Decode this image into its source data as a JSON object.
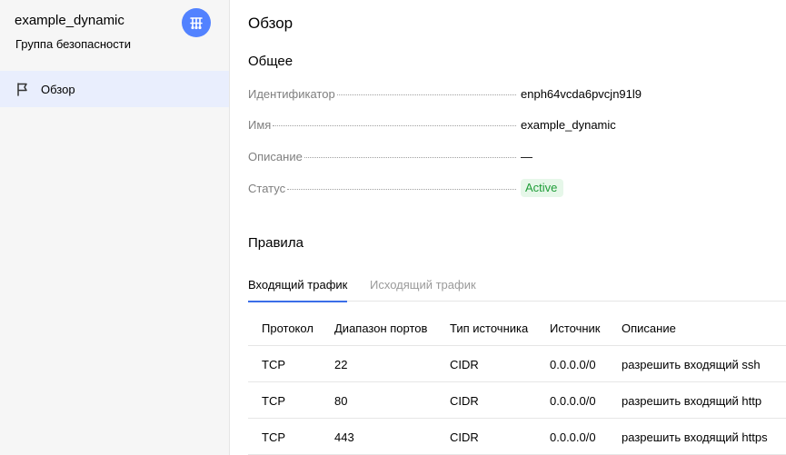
{
  "sidebar": {
    "title": "example_dynamic",
    "subtitle": "Группа безопасности",
    "logo_icon": "network-service-icon",
    "nav": [
      {
        "label": "Обзор",
        "icon": "flag-icon",
        "active": true
      }
    ]
  },
  "main": {
    "page_title": "Обзор",
    "general": {
      "title": "Общее",
      "fields": [
        {
          "key": "Идентификатор",
          "value": "enph64vcda6pvcjn91l9"
        },
        {
          "key": "Имя",
          "value": "example_dynamic"
        },
        {
          "key": "Описание",
          "value": "—"
        },
        {
          "key": "Статус",
          "value": "Active"
        }
      ]
    },
    "rules": {
      "title": "Правила",
      "tabs": [
        {
          "label": "Входящий трафик",
          "active": true
        },
        {
          "label": "Исходящий трафик",
          "active": false
        }
      ],
      "columns": [
        "Протокол",
        "Диапазон портов",
        "Тип источника",
        "Источник",
        "Описание"
      ],
      "rows": [
        [
          "TCP",
          "22",
          "CIDR",
          "0.0.0.0/0",
          "разрешить входящий ssh"
        ],
        [
          "TCP",
          "80",
          "CIDR",
          "0.0.0.0/0",
          "разрешить входящий http"
        ],
        [
          "TCP",
          "443",
          "CIDR",
          "0.0.0.0/0",
          "разрешить входящий https"
        ]
      ]
    }
  },
  "colors": {
    "accent": "#3b6ee8",
    "logo_bg": "#5282ff",
    "sidebar_active_bg": "#e9eefd",
    "status_active_text": "#1f9d38",
    "status_active_bg": "#e6f7e9"
  }
}
